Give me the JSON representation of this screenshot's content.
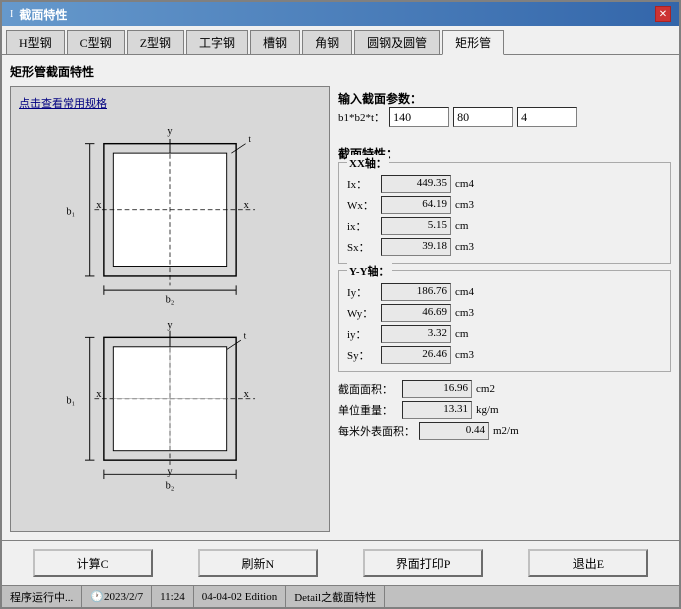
{
  "window": {
    "title": "截面特性",
    "title_icon": "I"
  },
  "tabs": [
    {
      "label": "H型钢",
      "active": false
    },
    {
      "label": "C型钢",
      "active": false
    },
    {
      "label": "Z型钢",
      "active": false
    },
    {
      "label": "工字钢",
      "active": false
    },
    {
      "label": "槽钢",
      "active": false
    },
    {
      "label": "角钢",
      "active": false
    },
    {
      "label": "圆钢及圆管",
      "active": false
    },
    {
      "label": "矩形管",
      "active": true
    }
  ],
  "section_title": "矩形管截面特性",
  "diagram_link": "点击查看常用规格",
  "input_section": {
    "title": "输入截面参数：",
    "dim_label": "b1*b2*t：",
    "b1_value": "140",
    "b2_value": "80",
    "t_value": "4"
  },
  "properties": {
    "title": "截面特性：",
    "xx_axis_label": "XX轴：",
    "Ix_label": "Ix：",
    "Ix_value": "449.35",
    "Ix_unit": "cm4",
    "Wx_label": "Wx：",
    "Wx_value": "64.19",
    "Wx_unit": "cm3",
    "ix_label": "ix：",
    "ix_value": "5.15",
    "ix_unit": "cm",
    "Sx_label": "Sx：",
    "Sx_value": "39.18",
    "Sx_unit": "cm3",
    "yy_axis_label": "Y-Y轴：",
    "Iy_label": "Iy：",
    "Iy_value": "186.76",
    "Iy_unit": "cm4",
    "Wy_label": "Wy：",
    "Wy_value": "46.69",
    "Wy_unit": "cm3",
    "iy_label": "iy：",
    "iy_value": "3.32",
    "iy_unit": "cm",
    "Sy_label": "Sy：",
    "Sy_value": "26.46",
    "Sy_unit": "cm3",
    "area_label": "截面面积：",
    "area_value": "16.96",
    "area_unit": "cm2",
    "weight_label": "单位重量：",
    "weight_value": "13.31",
    "weight_unit": "kg/m",
    "surface_label": "每米外表面积：",
    "surface_value": "0.44",
    "surface_unit": "m2/m"
  },
  "buttons": {
    "calc": "计算C",
    "refresh": "刷新N",
    "print": "界面打印P",
    "exit": "退出E"
  },
  "status": {
    "running": "程序运行中...",
    "date": "2023/2/7",
    "time": "11:24",
    "edition": "04-04-02 Edition",
    "module": "Detail之截面特性"
  }
}
